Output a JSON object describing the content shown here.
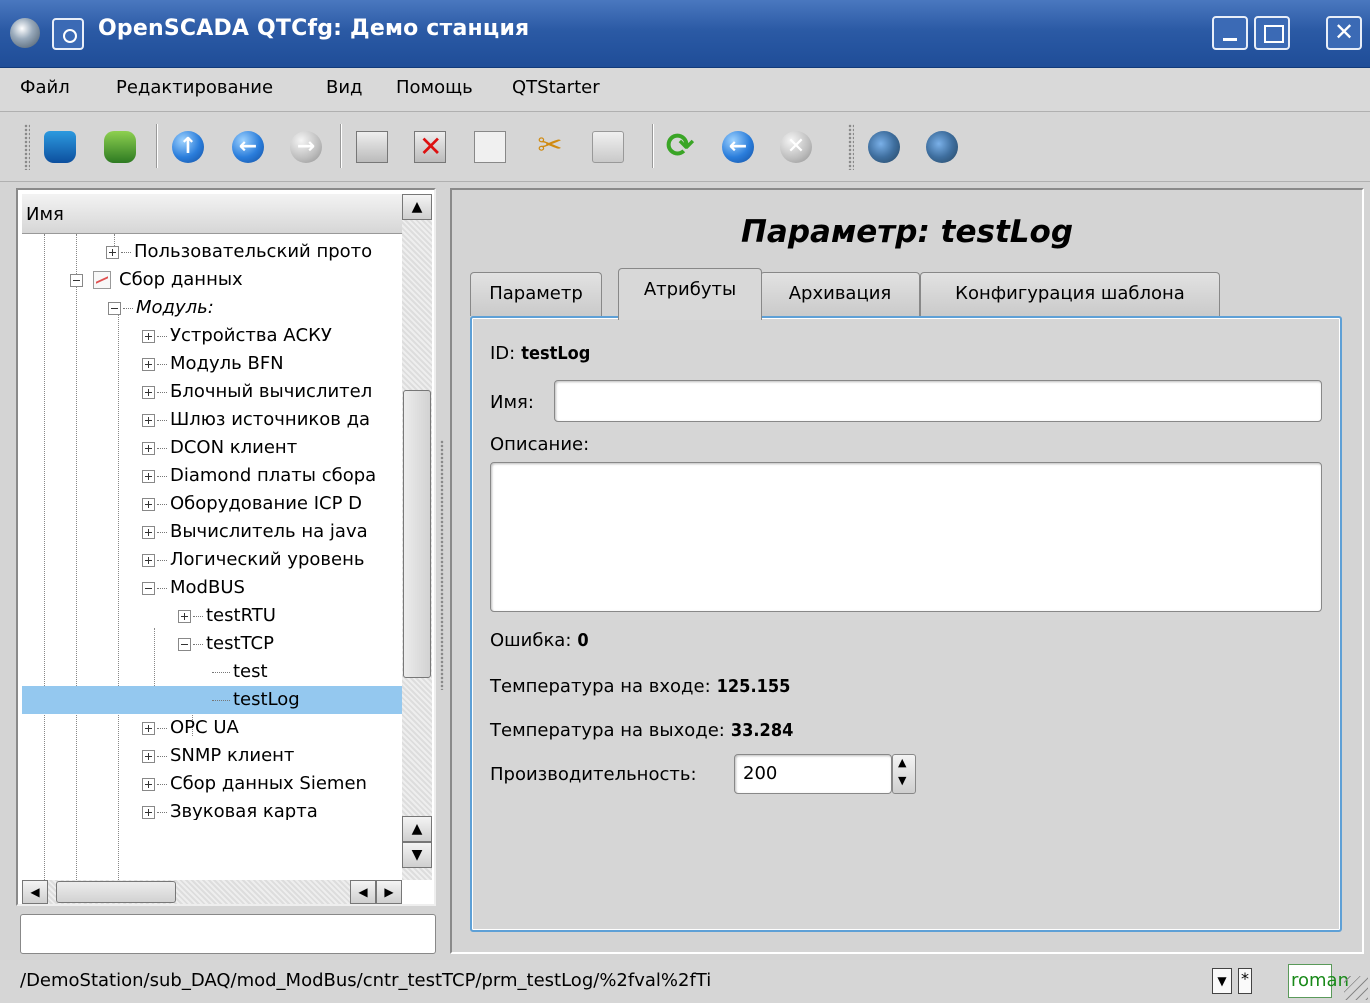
{
  "window": {
    "title": "OpenSCADA QTCfg: Демо станция"
  },
  "menubar": {
    "items": [
      "Файл",
      "Редактирование",
      "Вид",
      "Помощь",
      "QTStarter"
    ]
  },
  "toolbar": {
    "icons": [
      "db-load-icon",
      "db-save-icon",
      "up-icon",
      "back-icon",
      "forward-icon",
      "add-item-icon",
      "delete-item-icon",
      "copy-icon",
      "cut-icon",
      "paste-icon",
      "refresh-icon",
      "start-icon",
      "stop-icon",
      "config-tool-icon",
      "config-tool2-icon"
    ]
  },
  "tree": {
    "header": "Имя",
    "rows": [
      {
        "label": "Пользовательский прото",
        "indent": 3,
        "expander": "plus"
      },
      {
        "label": "Сбор данных",
        "indent": 1,
        "expander": "minus",
        "icon": "chart"
      },
      {
        "label": "Модуль:",
        "indent": 2,
        "expander": "minus",
        "italic": true
      },
      {
        "label": "Устройства АСКУ",
        "indent": 3,
        "expander": "plus"
      },
      {
        "label": "Модуль BFN",
        "indent": 3,
        "expander": "plus"
      },
      {
        "label": "Блочный вычислител",
        "indent": 3,
        "expander": "plus"
      },
      {
        "label": "Шлюз источников да",
        "indent": 3,
        "expander": "plus"
      },
      {
        "label": "DCON клиент",
        "indent": 3,
        "expander": "plus"
      },
      {
        "label": "Diamond платы сбора",
        "indent": 3,
        "expander": "plus"
      },
      {
        "label": "Оборудование ICP D",
        "indent": 3,
        "expander": "plus"
      },
      {
        "label": "Вычислитель на java",
        "indent": 3,
        "expander": "plus"
      },
      {
        "label": "Логический уровень",
        "indent": 3,
        "expander": "plus"
      },
      {
        "label": "ModBUS",
        "indent": 3,
        "expander": "minus"
      },
      {
        "label": "testRTU",
        "indent": 4,
        "expander": "plus"
      },
      {
        "label": "testTCP",
        "indent": 4,
        "expander": "minus"
      },
      {
        "label": "test",
        "indent": 5,
        "expander": "leaf"
      },
      {
        "label": "testLog",
        "indent": 5,
        "expander": "leaf",
        "selected": true
      },
      {
        "label": "OPC UA",
        "indent": 3,
        "expander": "plus"
      },
      {
        "label": "SNMP клиент",
        "indent": 3,
        "expander": "plus"
      },
      {
        "label": "Сбор данных Siemen",
        "indent": 3,
        "expander": "plus"
      },
      {
        "label": "Звуковая карта",
        "indent": 3,
        "expander": "plus"
      }
    ]
  },
  "panel": {
    "title": "Параметр: testLog",
    "tabs": [
      "Параметр",
      "Атрибуты",
      "Архивация",
      "Конфигурация шаблона"
    ],
    "active_tab": 1,
    "fields": {
      "id_label": "ID:",
      "id_value": "testLog",
      "name_label": "Имя:",
      "name_value": "",
      "descr_label": "Описание:",
      "descr_value": "",
      "error_label": "Ошибка:",
      "error_value": "0",
      "temp_in_label": "Температура на входе:",
      "temp_in_value": "125.155",
      "temp_out_label": "Температура на выходе:",
      "temp_out_value": "33.284",
      "perf_label": "Производительность:",
      "perf_value": "200"
    }
  },
  "status": {
    "path": "/DemoStation/sub_DAQ/mod_ModBus/cntr_testTCP/prm_testLog/%2fval%2fTi",
    "modified": "*",
    "user": "roman"
  }
}
